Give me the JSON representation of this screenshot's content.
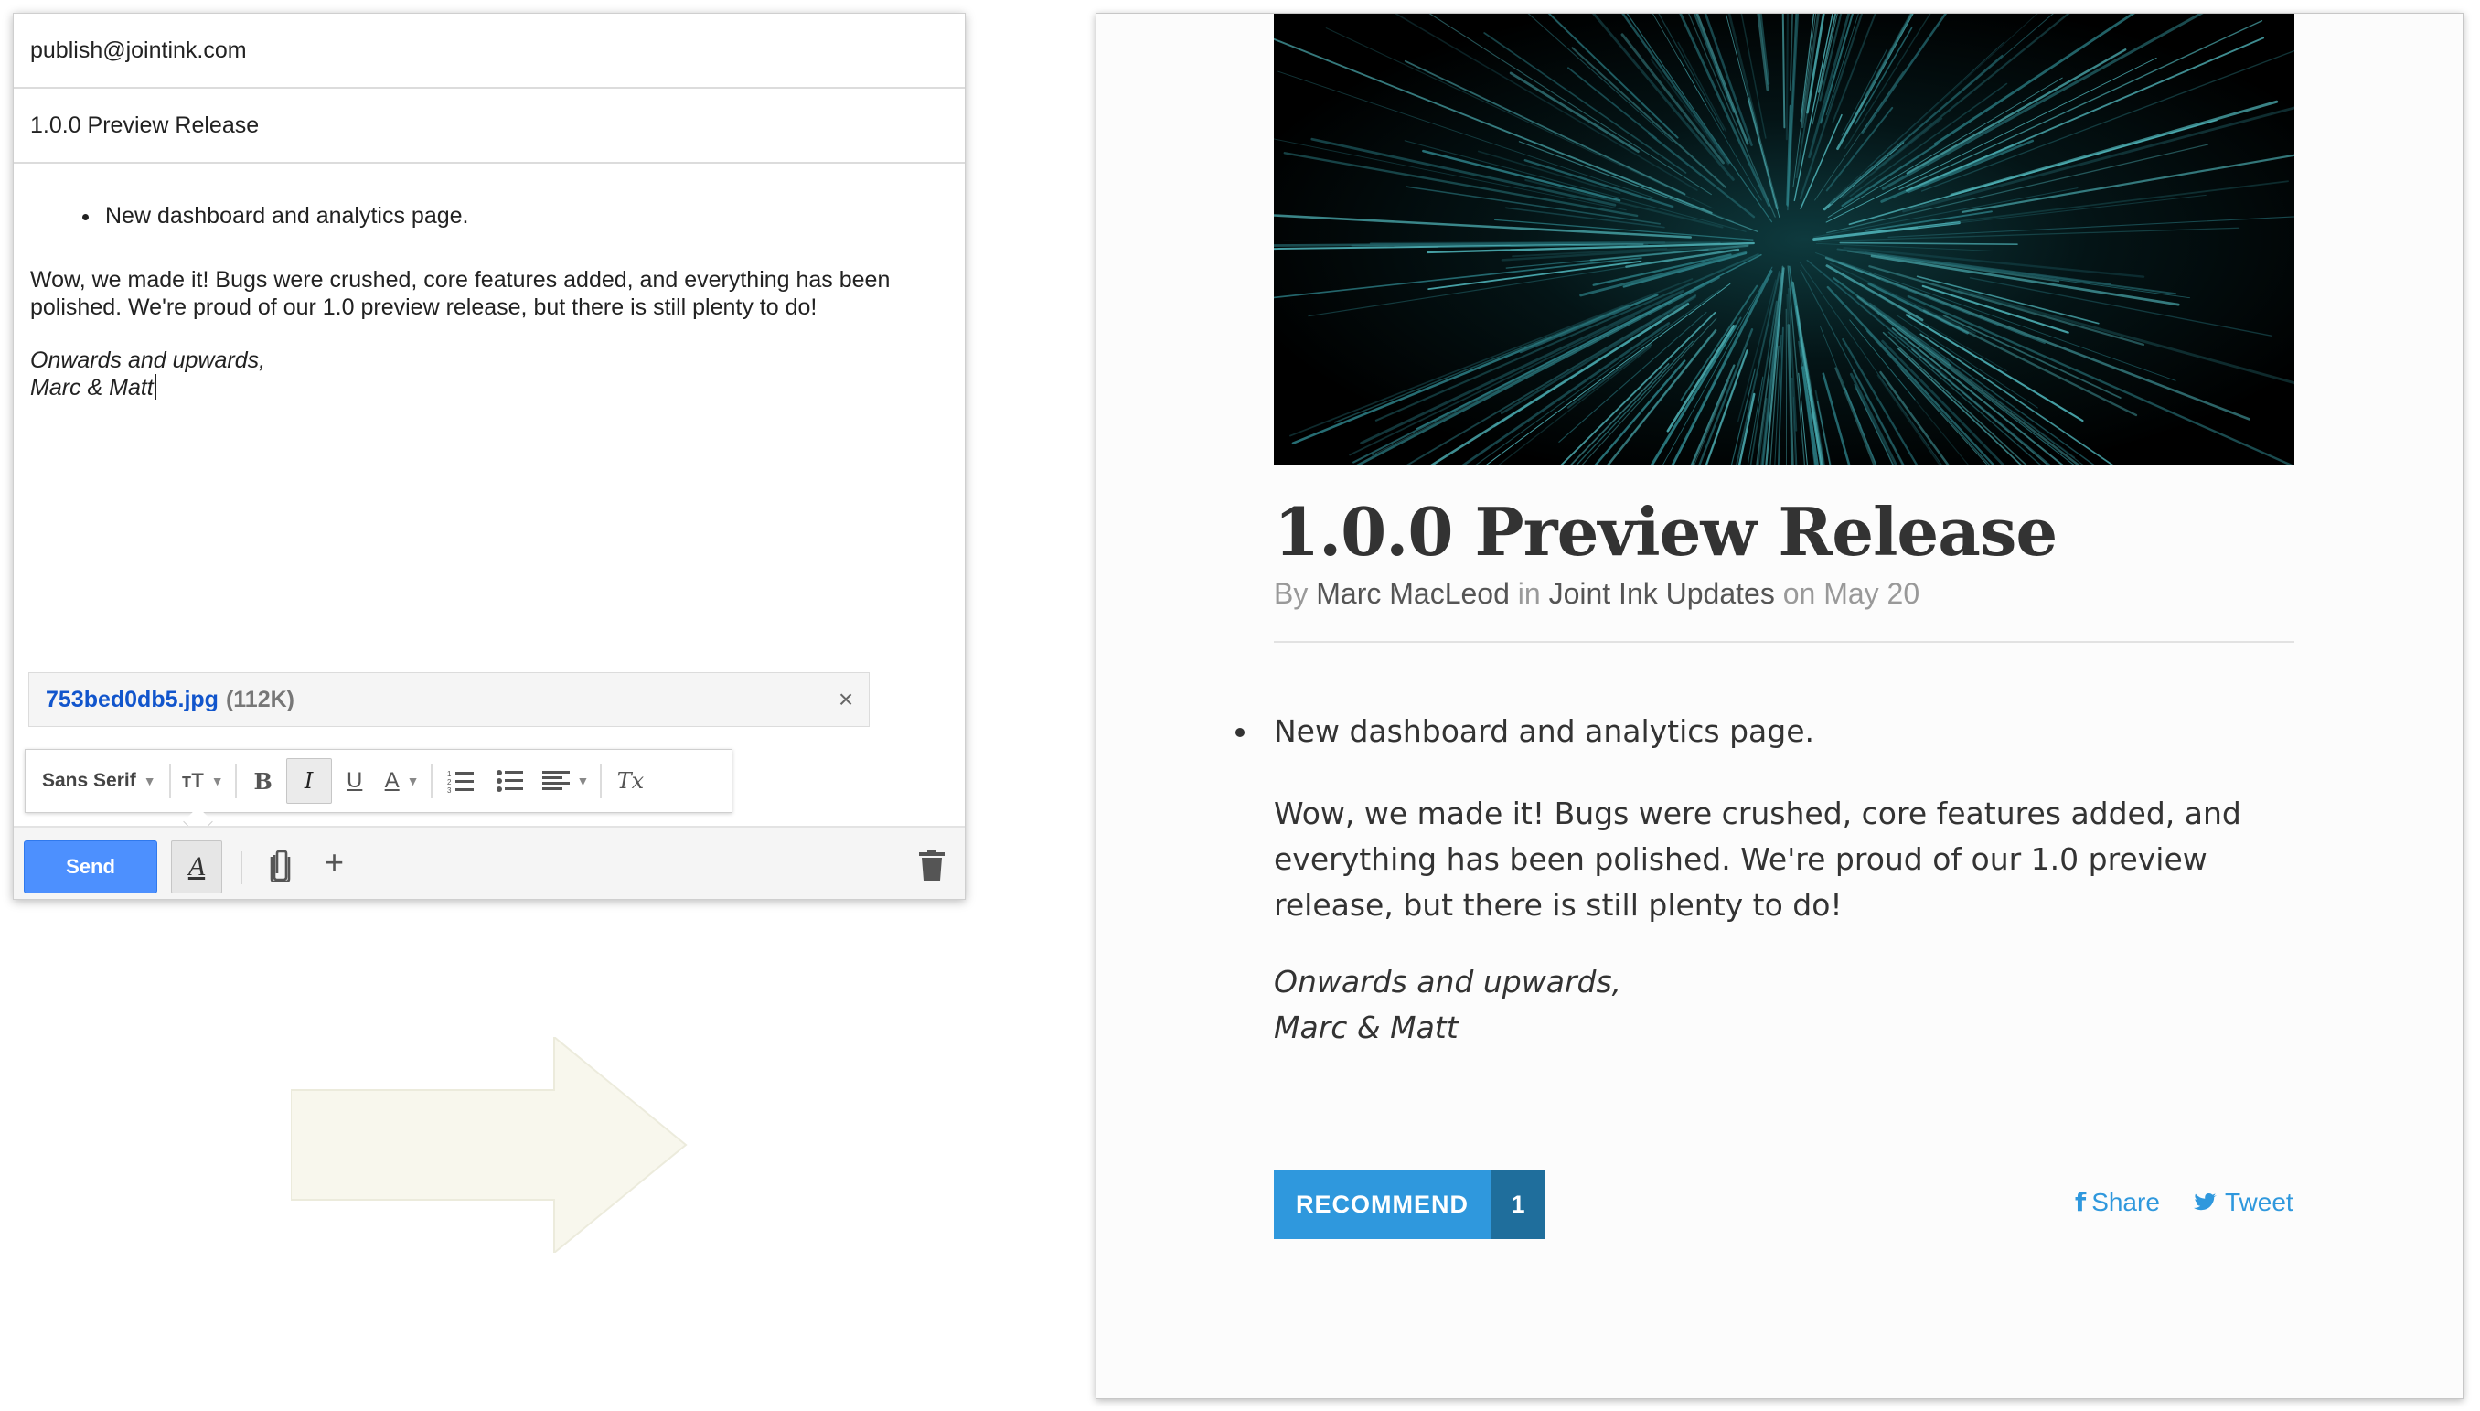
{
  "compose": {
    "to": "publish@jointink.com",
    "subject": "1.0.0 Preview Release",
    "body": {
      "bullet": "New dashboard and analytics page.",
      "paragraph_line1": "Wow, we made it! Bugs were crushed, core features added, and everything has been",
      "paragraph_line2": "polished. We're proud of our 1.0 preview release, but there is still plenty to do!",
      "sign_off": "Onwards and upwards,",
      "signature": "Marc & Matt"
    },
    "attachment": {
      "filename": "753bed0db5.jpg",
      "size": "(112K)",
      "close_glyph": "×"
    },
    "format_bar": {
      "font": "Sans Serif",
      "size_glyph": "тT",
      "bold": "B",
      "italic": "I",
      "underline": "U",
      "text_color": "A",
      "clear_formatting": "Tx"
    },
    "footer": {
      "send_label": "Send",
      "format_toggle": "A",
      "more_options": "+"
    }
  },
  "post": {
    "title": "1.0.0 Preview Release",
    "byline": {
      "by": "By",
      "author": "Marc MacLeod",
      "in": "in",
      "category": "Joint Ink Updates",
      "on": "on",
      "date": "May 20"
    },
    "body": {
      "bullet": "New dashboard and analytics page.",
      "paragraph": "Wow, we made it! Bugs were crushed, core features added, and everything has been polished. We're proud of our 1.0 preview release, but there is still plenty to do!",
      "sign_off": "Onwards and upwards,",
      "signature": "Marc & Matt"
    },
    "recommend": {
      "label": "RECOMMEND",
      "count": "1"
    },
    "share_label": "Share",
    "tweet_label": "Tweet"
  },
  "colors": {
    "gmail_send": "#4d90fe",
    "attachment_link": "#1155cc",
    "recommend": "#2f98dd",
    "recommend_count": "#1f6e9c",
    "arrow": "#f8f7ed"
  },
  "icons": [
    "close-icon",
    "dropdown-icon",
    "numbered-list-icon",
    "bulleted-list-icon",
    "align-icon",
    "attach-icon",
    "plus-icon",
    "trash-icon",
    "arrow-right-icon",
    "facebook-icon",
    "twitter-icon"
  ]
}
